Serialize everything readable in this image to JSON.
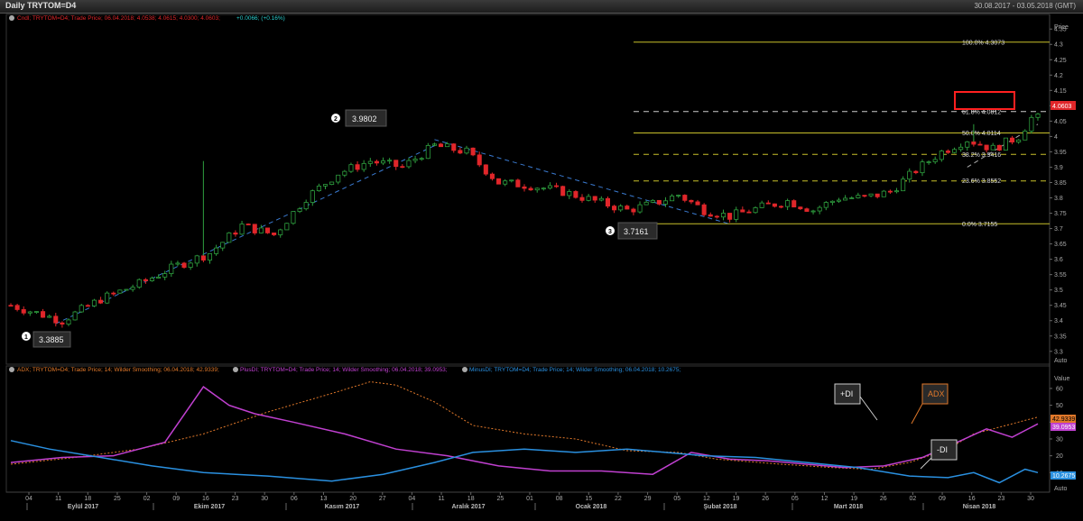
{
  "window": {
    "title": "Daily TRYTOM=D4",
    "date_range": "30.08.2017 - 03.05.2018 (GMT)"
  },
  "price_legend": {
    "text": "Cndl; TRYTOM=D4; Trade Price; 06.04.2018; 4.0538; 4.0615; 4.0300; 4.0603;",
    "change": "+0.0066; (+0.16%)"
  },
  "indicator_legend": {
    "adx": "ADX; TRYTOM=D4; Trade Price;  14; Wilder Smoothing; 06.04.2018; 42.9339;",
    "plusdi": "PlusDI; TRYTOM=D4; Trade Price;  14; Wilder Smoothing; 06.04.2018; 39.0953;",
    "minusdi": "MinusDI; TRYTOM=D4; Trade Price;  14; Wilder Smoothing; 06.04.2018; 10.2675;"
  },
  "axis_titles": {
    "price": "Price",
    "value": "Value",
    "auto": "Auto"
  },
  "annotations": {
    "p1": {
      "num": "1",
      "value": "3.3885"
    },
    "p2": {
      "num": "2",
      "value": "3.9802"
    },
    "p3": {
      "num": "3",
      "value": "3.7161"
    },
    "plusdi": "+DI",
    "adx": "ADX",
    "minusdi": "-DI"
  },
  "current": {
    "price": "4.0603",
    "adx": "42.9339",
    "plusdi": "39.0953",
    "minusdi": "10.2675"
  },
  "colors": {
    "up": "#2e9e3e",
    "down": "#e0262a",
    "fib": "#c8c02a",
    "adx": "#e0782a",
    "plusdi": "#c040d0",
    "minusdi": "#2a90e0",
    "trend": "#3a7ad0"
  },
  "chart_data": [
    {
      "type": "candlestick",
      "ylim": [
        3.27,
        4.38
      ],
      "y_ticks": [
        "3.3",
        "3.35",
        "3.4",
        "3.45",
        "3.5",
        "3.55",
        "3.6",
        "3.65",
        "3.7",
        "3.75",
        "3.8",
        "3.85",
        "3.9",
        "3.95",
        "4",
        "4.05",
        "4.1",
        "4.15",
        "4.2",
        "4.25",
        "4.3",
        "4.35"
      ],
      "x_ticks": [
        "04",
        "11",
        "18",
        "25",
        "02",
        "09",
        "16",
        "23",
        "30",
        "06",
        "13",
        "20",
        "27",
        "04",
        "11",
        "18",
        "25",
        "01",
        "08",
        "15",
        "22",
        "29",
        "05",
        "12",
        "19",
        "26",
        "05",
        "12",
        "19",
        "26",
        "02",
        "09",
        "16",
        "23",
        "30"
      ],
      "months": [
        "Eylül 2017",
        "Ekim 2017",
        "Kasım 2017",
        "Aralık 2017",
        "Ocak 2018",
        "Şubat 2018",
        "Mart 2018",
        "Nisan 2018"
      ],
      "fibonacci": [
        {
          "label": "100.0%",
          "value": "4.3073"
        },
        {
          "label": "61.8%",
          "value": "4.0812"
        },
        {
          "label": "50.0%",
          "value": "4.0114"
        },
        {
          "label": "38.2%",
          "value": "3.9416"
        },
        {
          "label": "23.6%",
          "value": "3.8552"
        },
        {
          "label": "0.0%",
          "value": "3.7155"
        }
      ],
      "close_path": [
        [
          0,
          3.45
        ],
        [
          8,
          3.4
        ],
        [
          14,
          3.47
        ],
        [
          20,
          3.52
        ],
        [
          26,
          3.58
        ],
        [
          31,
          3.62
        ],
        [
          36,
          3.71
        ],
        [
          41,
          3.68
        ],
        [
          46,
          3.8
        ],
        [
          51,
          3.88
        ],
        [
          56,
          3.92
        ],
        [
          61,
          3.9
        ],
        [
          66,
          3.97
        ],
        [
          71,
          3.95
        ],
        [
          76,
          3.85
        ],
        [
          81,
          3.84
        ],
        [
          86,
          3.82
        ],
        [
          91,
          3.79
        ],
        [
          96,
          3.76
        ],
        [
          100,
          3.78
        ],
        [
          104,
          3.81
        ],
        [
          108,
          3.76
        ],
        [
          112,
          3.74
        ],
        [
          117,
          3.77
        ],
        [
          121,
          3.79
        ],
        [
          125,
          3.76
        ],
        [
          129,
          3.8
        ],
        [
          133,
          3.8
        ],
        [
          137,
          3.82
        ],
        [
          141,
          3.89
        ],
        [
          145,
          3.95
        ],
        [
          149,
          3.99
        ],
        [
          153,
          3.96
        ],
        [
          157,
          4.0
        ],
        [
          159,
          4.06
        ]
      ],
      "spikes": [
        [
          30,
          3.92
        ],
        [
          66,
          3.98
        ],
        [
          150,
          4.04
        ]
      ]
    },
    {
      "type": "line",
      "ylim": [
        0,
        68
      ],
      "y_ticks": [
        "10",
        "20",
        "30",
        "40",
        "50",
        "60"
      ],
      "series": [
        {
          "name": "ADX",
          "values": [
            [
              0,
              15
            ],
            [
              10,
              19
            ],
            [
              20,
              24
            ],
            [
              30,
              33
            ],
            [
              40,
              46
            ],
            [
              50,
              57
            ],
            [
              56,
              64
            ],
            [
              60,
              62
            ],
            [
              66,
              52
            ],
            [
              72,
              38
            ],
            [
              80,
              33
            ],
            [
              88,
              30
            ],
            [
              96,
              23
            ],
            [
              104,
              22
            ],
            [
              110,
              18
            ],
            [
              120,
              15
            ],
            [
              128,
              13
            ],
            [
              134,
              12
            ],
            [
              140,
              16
            ],
            [
              146,
              24
            ],
            [
              150,
              33
            ],
            [
              154,
              37
            ],
            [
              158,
              41
            ],
            [
              160,
              43
            ]
          ]
        },
        {
          "name": "+DI",
          "values": [
            [
              0,
              16
            ],
            [
              8,
              19
            ],
            [
              16,
              20
            ],
            [
              24,
              28
            ],
            [
              30,
              61
            ],
            [
              34,
              50
            ],
            [
              38,
              45
            ],
            [
              44,
              40
            ],
            [
              52,
              33
            ],
            [
              60,
              24
            ],
            [
              68,
              20
            ],
            [
              76,
              14
            ],
            [
              84,
              11
            ],
            [
              92,
              11
            ],
            [
              100,
              9
            ],
            [
              106,
              22
            ],
            [
              112,
              18
            ],
            [
              118,
              17
            ],
            [
              124,
              15
            ],
            [
              130,
              13
            ],
            [
              136,
              14
            ],
            [
              142,
              19
            ],
            [
              148,
              29
            ],
            [
              152,
              36
            ],
            [
              156,
              31
            ],
            [
              160,
              39
            ]
          ]
        },
        {
          "name": "-DI",
          "values": [
            [
              0,
              29
            ],
            [
              6,
              24
            ],
            [
              14,
              19
            ],
            [
              22,
              14
            ],
            [
              30,
              10
            ],
            [
              40,
              8
            ],
            [
              50,
              5
            ],
            [
              58,
              9
            ],
            [
              66,
              16
            ],
            [
              72,
              22
            ],
            [
              80,
              24
            ],
            [
              88,
              22
            ],
            [
              96,
              24
            ],
            [
              102,
              22
            ],
            [
              108,
              20
            ],
            [
              116,
              19
            ],
            [
              124,
              16
            ],
            [
              132,
              13
            ],
            [
              140,
              8
            ],
            [
              146,
              7
            ],
            [
              150,
              10
            ],
            [
              154,
              4
            ],
            [
              158,
              12
            ],
            [
              160,
              10
            ]
          ]
        }
      ]
    }
  ]
}
